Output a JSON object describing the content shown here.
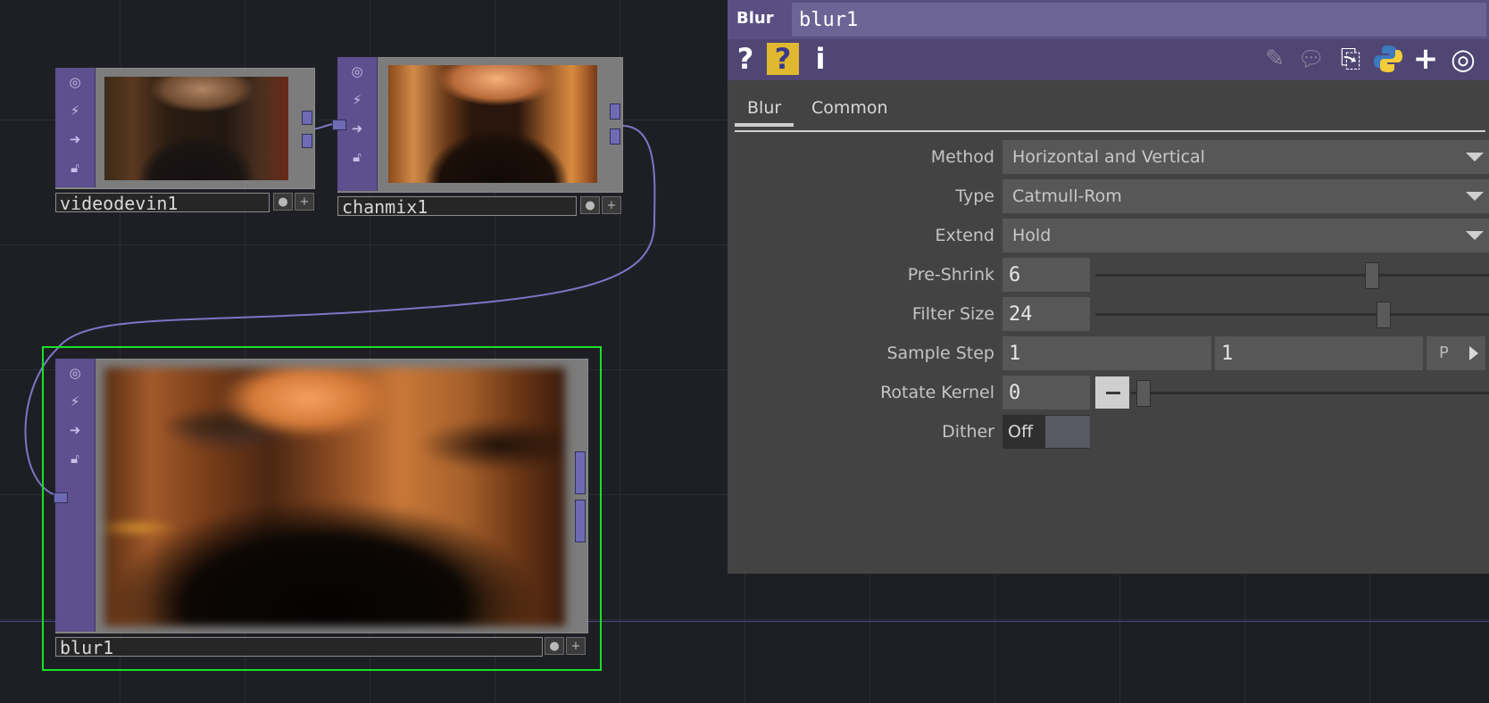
{
  "network": {
    "nodes": [
      {
        "name": "videodevin1"
      },
      {
        "name": "chanmix1"
      },
      {
        "name": "blur1"
      }
    ]
  },
  "panel": {
    "op_type": "Blur",
    "op_name": "blur1",
    "tabs": [
      "Blur",
      "Common"
    ],
    "active_tab": "Blur",
    "params": {
      "method": {
        "label": "Method",
        "value": "Horizontal and Vertical"
      },
      "type": {
        "label": "Type",
        "value": "Catmull-Rom"
      },
      "extend": {
        "label": "Extend",
        "value": "Hold"
      },
      "preshrink": {
        "label": "Pre-Shrink",
        "value": "6",
        "slider_fraction": 0.71
      },
      "filtersize": {
        "label": "Filter Size",
        "value": "24",
        "slider_fraction": 0.74
      },
      "samplestep": {
        "label": "Sample Step",
        "value1": "1",
        "value2": "1",
        "button": "P"
      },
      "rotatekernel": {
        "label": "Rotate Kernel",
        "value": "0",
        "slider_fraction": 0.0
      },
      "dither": {
        "label": "Dither",
        "value": "Off"
      }
    },
    "toolbar": {
      "help": "?",
      "help_op": "?",
      "info": "i"
    }
  },
  "colors": {
    "selection": "#19e02a",
    "node_strip": "#5e4f8e",
    "panel_title": "#5a4f82",
    "wire": "#7d75c6"
  }
}
